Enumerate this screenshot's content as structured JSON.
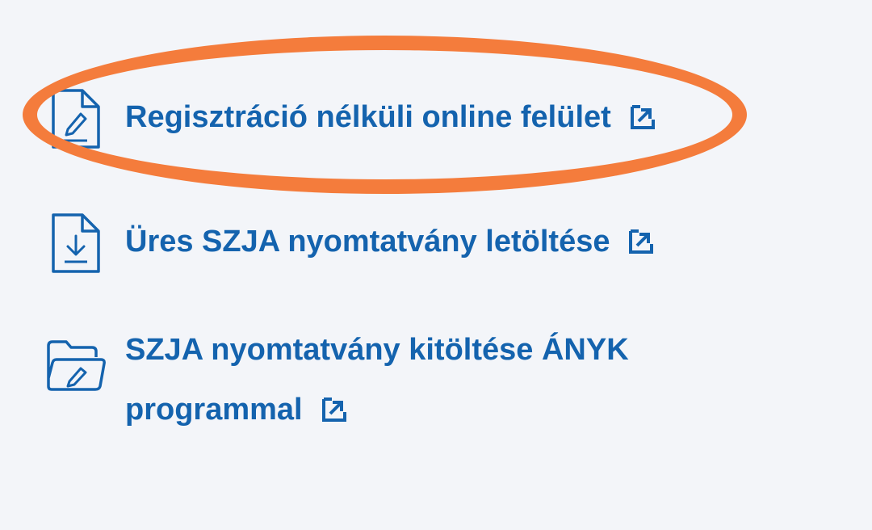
{
  "links": [
    {
      "label": "Regisztráció nélküli online felület",
      "icon": "document-edit-icon"
    },
    {
      "label": "Üres SZJA nyomtatvány letöltése",
      "icon": "document-download-icon"
    },
    {
      "line1": "SZJA nyomtatvány kitöltése ÁNYK",
      "line2": "programmal",
      "icon": "folder-edit-icon"
    }
  ],
  "external_icon": "external-link-icon",
  "highlight": {
    "color": "#f47c3c",
    "target": "Regisztráció nélküli online felület"
  },
  "colors": {
    "link": "#1463ae",
    "background": "#f3f5f9"
  }
}
